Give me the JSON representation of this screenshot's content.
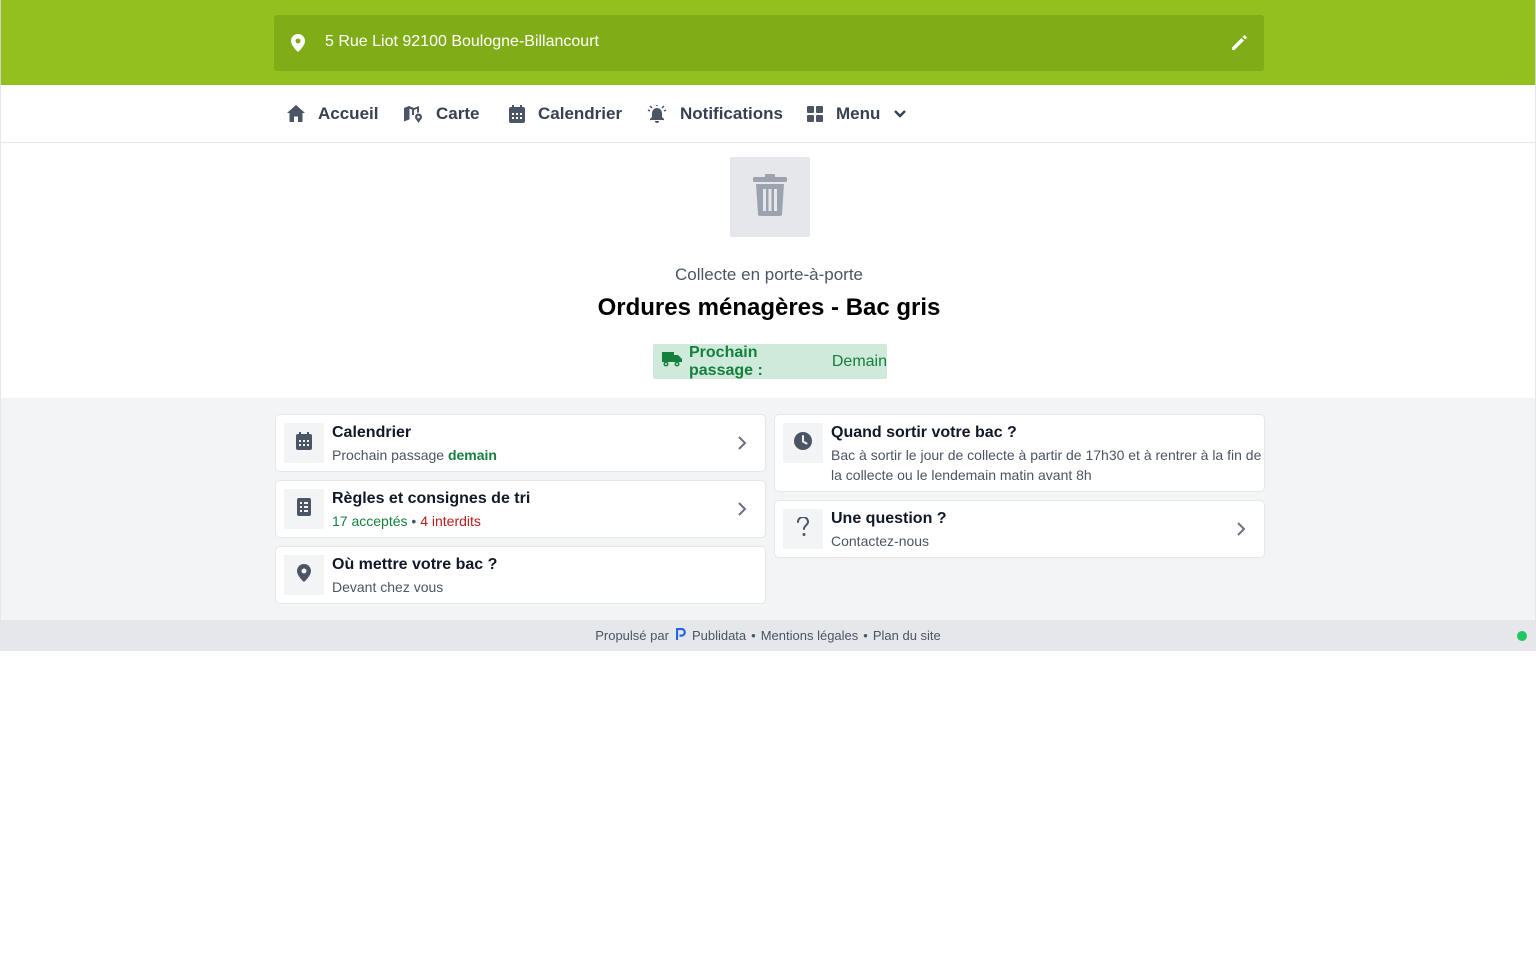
{
  "header": {
    "address": "5 Rue Liot 92100 Boulogne-Billancourt",
    "pin_icon": "map-pin-icon",
    "edit_icon": "pencil-icon",
    "bg_color": "#93c01f"
  },
  "nav": {
    "items": [
      {
        "label": "Accueil",
        "icon": "home-icon"
      },
      {
        "label": "Carte",
        "icon": "map-icon"
      },
      {
        "label": "Calendrier",
        "icon": "calendar-icon"
      },
      {
        "label": "Notifications",
        "icon": "bell-icon"
      },
      {
        "label": "Menu",
        "icon": "grid-icon"
      }
    ]
  },
  "hero": {
    "icon": "trash-icon",
    "subtitle": "Collecte en porte-à-porte",
    "title": "Ordures ménagères - Bac gris",
    "badge_label": "Prochain passage :",
    "badge_value": "Demain"
  },
  "cards": {
    "calendar": {
      "title": "Calendrier",
      "text": "Prochain passage",
      "highlight": "demain",
      "icon": "calendar-icon"
    },
    "rules": {
      "title": "Règles et consignes de tri",
      "accepted_count": "17",
      "accepted_label": "acceptés",
      "separator": "•",
      "forbidden_count": "4",
      "forbidden_label": "interdits",
      "icon": "checklist-icon"
    },
    "where": {
      "title": "Où mettre votre bac ?",
      "text": "Devant chez vous",
      "icon": "map-pin-icon"
    },
    "when": {
      "title": "Quand sortir votre bac ?",
      "line1": "Bac à sortir le jour de collecte à partir de 17h30 et à rentrer à la fin de",
      "line2": "la collecte ou le lendemain matin avant 8h",
      "icon": "clock-icon"
    },
    "question": {
      "title": "Une question ?",
      "text": "Contactez-nous",
      "icon": "question-icon"
    }
  },
  "footer": {
    "powered_by": "Propulsé par",
    "brand": "Publidata",
    "legal": "Mentions légales",
    "sitemap": "Plan du site",
    "separator": "•"
  }
}
